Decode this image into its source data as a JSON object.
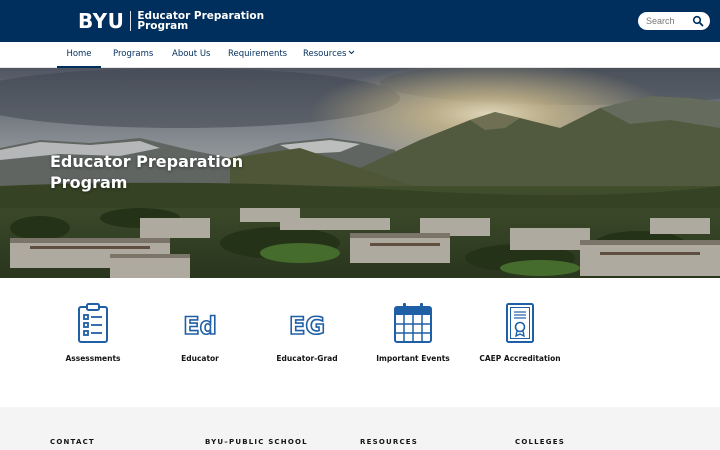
{
  "header": {
    "logo_text": "BYU",
    "site_title_line1": "Educator Preparation",
    "site_title_line2": "Program",
    "search_placeholder": "Search"
  },
  "nav": {
    "items": [
      {
        "label": "Home",
        "active": true
      },
      {
        "label": "Programs"
      },
      {
        "label": "About Us"
      },
      {
        "label": "Requirements"
      },
      {
        "label": "Resources",
        "has_dropdown": true
      }
    ]
  },
  "hero": {
    "title_line1": "Educator Preparation",
    "title_line2": "Program"
  },
  "quick_links": [
    {
      "label": "Assessments",
      "icon": "clipboard-checklist-icon"
    },
    {
      "label": "Educator",
      "icon": "ed-letters-icon"
    },
    {
      "label": "Educator-Grad",
      "icon": "eg-letters-icon"
    },
    {
      "label": "Important Events",
      "icon": "calendar-icon"
    },
    {
      "label": "CAEP Accreditation",
      "icon": "certificate-icon"
    }
  ],
  "footer": {
    "headings": [
      "CONTACT",
      "BYU–PUBLIC SCHOOL",
      "RESOURCES",
      "COLLEGES"
    ]
  },
  "colors": {
    "brand_navy": "#002e5d",
    "icon_blue": "#1f5fa6",
    "footer_bg": "#f4f4f4"
  }
}
